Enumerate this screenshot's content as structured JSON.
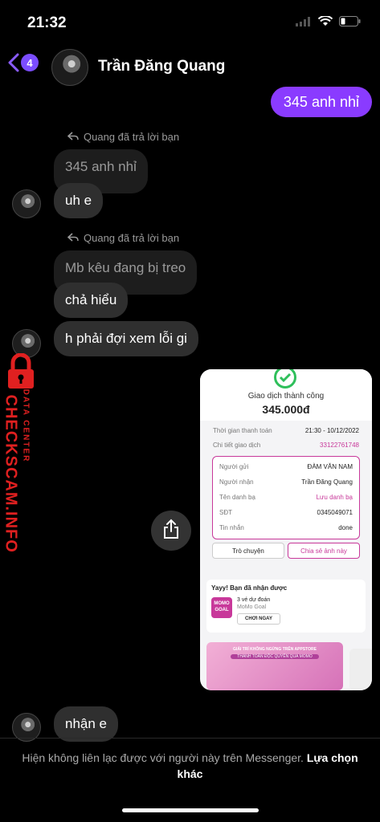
{
  "status_bar": {
    "time": "21:32"
  },
  "header": {
    "unread_badge": "4",
    "contact_name": "Trần Đăng Quang"
  },
  "messages": {
    "outgoing_1": "345 anh nhỉ",
    "reply_label_1": "Quang đã trả lời bạn",
    "quoted_1": "345 anh nhỉ",
    "incoming_1": "uh e",
    "reply_label_2": "Quang đã trả lời bạn",
    "quoted_2": "Mb kêu đang bị treo",
    "incoming_2": "chả hiểu",
    "incoming_3": "h phải đợi xem lỗi gi",
    "incoming_4": "nhận e"
  },
  "watermark": {
    "main": "CHECKSCAM.INFO",
    "sub": "DATA CENTER"
  },
  "receipt": {
    "status": "Giao dịch thành công",
    "amount": "345.000đ",
    "time_label": "Thời gian thanh toán",
    "time_value": "21:30 - 10/12/2022",
    "detail_label": "Chi tiết giao dịch",
    "detail_value": "33122761748",
    "sender_label": "Người gửi",
    "sender_value": "ĐÀM VĂN NAM",
    "receiver_label": "Người nhận",
    "receiver_value": "Trần Đăng Quang",
    "contact_label": "Tên danh bạ",
    "contact_value": "Lưu danh bạ",
    "phone_label": "SĐT",
    "phone_value": "0345049071",
    "message_label": "Tin nhắn",
    "message_value": "done",
    "chat_button": "Trò chuyện",
    "share_button": "Chia sẻ ảnh này",
    "promo_title": "Yayy! Bạn đã nhận được",
    "promo_icon": "MOMO GOAL",
    "promo_line1": "3 vé dự đoán",
    "promo_line2": "MoMo Goal",
    "promo_button": "CHƠI NGAY",
    "banner_line1": "GIẢI TRÍ KHÔNG NGỪNG TRÊN APPSTORE",
    "banner_line2": "THANH TOÁN ĐỘC QUYỀN QUA MOMO"
  },
  "footer": {
    "notice": "Hiện không liên lạc được với người này trên Messenger.",
    "link": "Lựa chọn khác"
  },
  "colors": {
    "accent": "#8a3bff",
    "badge": "#7b4dff",
    "watermark": "#e02020",
    "momo": "#c8389a"
  }
}
